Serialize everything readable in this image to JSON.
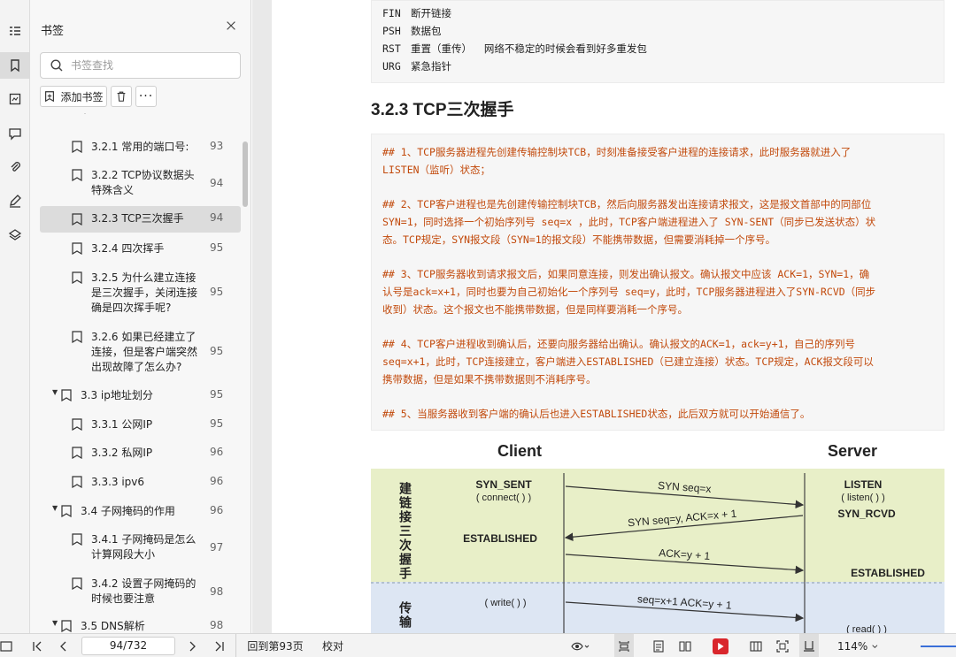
{
  "panel": {
    "title": "书签",
    "search_placeholder": "书签查找",
    "add_bookmark_label": "添加书签"
  },
  "bookmarks": [
    {
      "label": "3.2.1 常用的端口号:",
      "page": "93"
    },
    {
      "label": "3.2.2 TCP协议数据头特殊含义",
      "page": "94"
    },
    {
      "label": "3.2.3 TCP三次握手",
      "page": "94"
    },
    {
      "label": "3.2.4 四次挥手",
      "page": "95"
    },
    {
      "label": "3.2.5 为什么建立连接是三次握手，关闭连接确是四次挥手呢?",
      "page": "95"
    },
    {
      "label": "3.2.6 如果已经建立了连接，但是客户端突然出现故障了怎么办?",
      "page": "95"
    },
    {
      "label": "3.3 ip地址划分",
      "page": "95"
    },
    {
      "label": "3.3.1 公网IP",
      "page": "95"
    },
    {
      "label": "3.3.2 私网IP",
      "page": "96"
    },
    {
      "label": "3.3.3 ipv6",
      "page": "96"
    },
    {
      "label": "3.4 子网掩码的作用",
      "page": "96"
    },
    {
      "label": "3.4.1 子网掩码是怎么计算网段大小",
      "page": "97"
    },
    {
      "label": "3.4.2 设置子网掩码的时候也要注意",
      "page": "98"
    },
    {
      "label": "3.5 DNS解析",
      "page": "98"
    }
  ],
  "doc": {
    "flags": [
      {
        "name": "FIN",
        "desc": "断开链接"
      },
      {
        "name": "PSH",
        "desc": "数据包"
      },
      {
        "name": "RST",
        "desc": "重置（重传）  网络不稳定的时候会看到好多重发包"
      },
      {
        "name": "URG",
        "desc": "紧急指针"
      }
    ],
    "heading": "3.2.3 TCP三次握手",
    "steps": [
      [
        "## 1、TCP服务器进程先创建传输控制块TCB，时刻准备接受客户进程的连接请求，此时服务器就进入了",
        "LISTEN（监听）状态；"
      ],
      [
        "## 2、TCP客户进程也是先创建传输控制块TCB，然后向服务器发出连接请求报文，这是报文首部中的同部位",
        "SYN=1，同时选择一个初始序列号  seq=x ，此时，TCP客户端进程进入了  SYN-SENT（同步已发送状态）状",
        "态。TCP规定，SYN报文段（SYN=1的报文段）不能携带数据，但需要消耗掉一个序号。"
      ],
      [
        "## 3、TCP服务器收到请求报文后，如果同意连接，则发出确认报文。确认报文中应该 ACK=1，SYN=1，确",
        "认号是ack=x+1，同时也要为自己初始化一个序列号  seq=y，此时，TCP服务器进程进入了SYN-RCVD（同步",
        "收到）状态。这个报文也不能携带数据，但是同样要消耗一个序号。"
      ],
      [
        "## 4、TCP客户进程收到确认后，还要向服务器给出确认。确认报文的ACK=1，ack=y+1，自己的序列号",
        "seq=x+1，此时，TCP连接建立，客户端进入ESTABLISHED（已建立连接）状态。TCP规定，ACK报文段可以",
        "携带数据，但是如果不携带数据则不消耗序号。"
      ],
      [
        "## 5、当服务器收到客户端的确认后也进入ESTABLISHED状态，此后双方就可以开始通信了。"
      ]
    ],
    "diagram": {
      "client": "Client",
      "server": "Server",
      "phase1": "建链接三次握手",
      "phase2": "传输",
      "client_state1": "SYN_SENT",
      "client_call1": "( connect( ) )",
      "client_state2": "ESTABLISHED",
      "client_call2": "( write( ) )",
      "server_state1": "LISTEN",
      "server_call1": "( listen( ) )",
      "server_state2": "SYN_RCVD",
      "server_state3": "ESTABLISHED",
      "server_call2": "( read( ) )",
      "msg1": "SYN seq=x",
      "msg2": "SYN seq=y, ACK=x + 1",
      "msg3": "ACK=y + 1",
      "msg4": "seq=x+1 ACK=y + 1"
    }
  },
  "status": {
    "page_value": "94/732",
    "back_label": "回到第93页",
    "proofread_label": "校对",
    "zoom": "114%"
  },
  "colors": {
    "accent_red": "#d9262c",
    "code_orange": "#c24a0c"
  }
}
